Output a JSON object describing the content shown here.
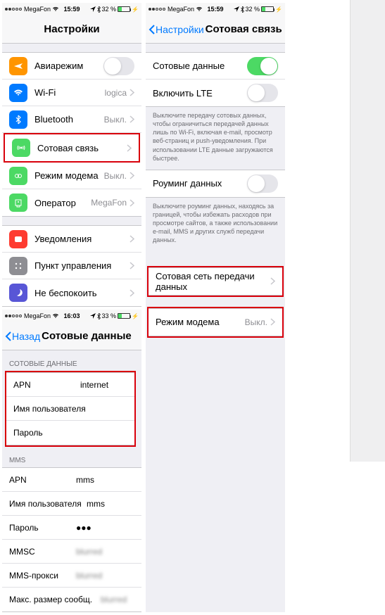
{
  "status": {
    "carrier": "MegaFon",
    "time1": "15:59",
    "time2": "15:59",
    "time3": "16:03",
    "battery": "32 %",
    "battery3": "33 %"
  },
  "screen1": {
    "title": "Настройки",
    "rows": [
      {
        "label": "Авиарежим",
        "icon": "#ff9500"
      },
      {
        "label": "Wi-Fi",
        "val": "logica",
        "icon": "#007aff"
      },
      {
        "label": "Bluetooth",
        "val": "Выкл.",
        "icon": "#007aff"
      },
      {
        "label": "Сотовая связь",
        "icon": "#4cd964",
        "hl": true
      },
      {
        "label": "Режим модема",
        "val": "Выкл.",
        "icon": "#4cd964"
      },
      {
        "label": "Оператор",
        "val": "MegaFon",
        "icon": "#4cd964"
      }
    ],
    "rows2": [
      {
        "label": "Уведомления",
        "icon": "#686a6f"
      },
      {
        "label": "Пункт управления",
        "icon": "#686a6f"
      },
      {
        "label": "Не беспокоить",
        "icon": "#686a6f"
      }
    ]
  },
  "screen2": {
    "back": "Настройки",
    "title": "Сотовая связь",
    "r1": {
      "label": "Сотовые данные"
    },
    "r2": {
      "label": "Включить LTE"
    },
    "desc1": "Выключите передачу сотовых данных, чтобы ограничиться передачей данных лишь по Wi-Fi, включая e-mail, просмотр веб-страниц и push-уведомления. При использовании LTE данные загружаются быстрее.",
    "r3": {
      "label": "Роуминг данных"
    },
    "desc2": "Выключите роуминг данных, находясь за границей, чтобы избежать расходов при просмотре сайтов, а также использовании e-mail, MMS и других служб передачи данных.",
    "r4": {
      "label": "Сотовая сеть передачи данных"
    },
    "r5": {
      "label": "Режим модема",
      "val": "Выкл."
    }
  },
  "screen3": {
    "back": "Назад",
    "title": "Сотовые данные",
    "head1": "СОТОВЫЕ ДАННЫЕ",
    "g1": [
      {
        "label": "APN",
        "val": "internet"
      },
      {
        "label": "Имя пользователя",
        "val": ""
      },
      {
        "label": "Пароль",
        "val": ""
      }
    ],
    "head2": "MMS",
    "g2": [
      {
        "label": "APN",
        "val": "mms"
      },
      {
        "label": "Имя пользователя",
        "val": "mms"
      },
      {
        "label": "Пароль",
        "val": "●●●"
      },
      {
        "label": "MMSC",
        "val": "blurred",
        "blur": true
      },
      {
        "label": "MMS-прокси",
        "val": "blurred",
        "blur": true
      },
      {
        "label": "Макс. размер сообщ.",
        "val": "blurred",
        "blur": true
      }
    ]
  }
}
